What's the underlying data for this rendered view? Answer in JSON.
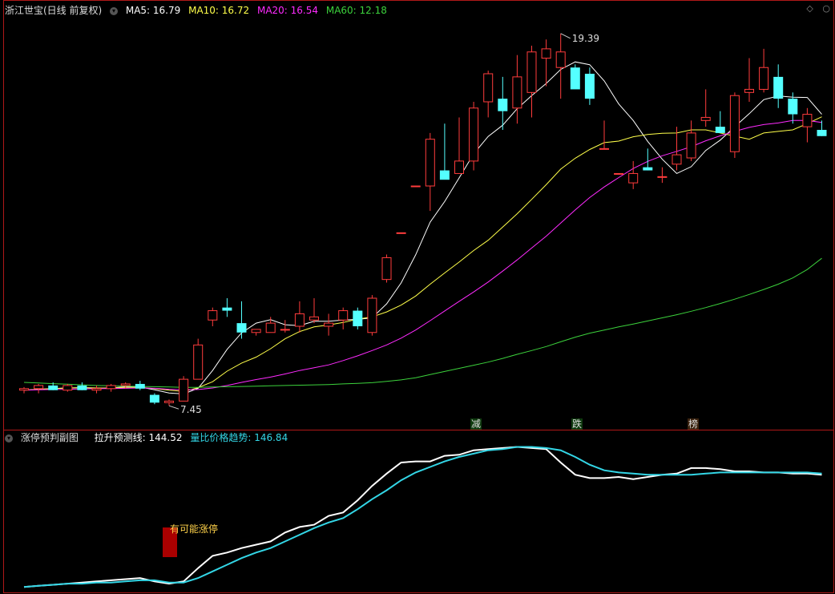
{
  "main_header": {
    "title": "浙江世宝(日线 前复权)",
    "ma5": "MA5: 16.79",
    "ma10": "MA10: 16.72",
    "ma20": "MA20: 16.54",
    "ma60": "MA60: 12.18"
  },
  "sub_header": {
    "title": "涨停预判副图",
    "line1": "拉升预测线: 144.52",
    "line2": "量比价格趋势: 146.84"
  },
  "annotations": {
    "high": "19.39",
    "low": "7.45",
    "limit_up_note": "有可能涨停",
    "tag_jian": "减",
    "tag_die": "跌",
    "tag_bang": "榜"
  },
  "colors": {
    "up": "#ff3c3c",
    "down": "#54ffff",
    "ma5": "#ffffff",
    "ma10": "#ffff4a",
    "ma20": "#ff2bff",
    "ma60": "#3cd23c",
    "line1": "#ffffff",
    "line2": "#33d6e6",
    "border": "#b01818"
  },
  "chart_data": [
    {
      "type": "candlestick",
      "ohlc": [
        [
          7.95,
          8.05,
          7.85,
          8.0
        ],
        [
          8.0,
          8.15,
          7.85,
          8.1
        ],
        [
          8.1,
          8.2,
          7.95,
          7.95
        ],
        [
          7.95,
          8.15,
          7.9,
          8.1
        ],
        [
          8.1,
          8.2,
          7.95,
          7.95
        ],
        [
          7.95,
          8.1,
          7.85,
          8.0
        ],
        [
          8.0,
          8.15,
          7.9,
          8.1
        ],
        [
          8.1,
          8.2,
          8.0,
          8.15
        ],
        [
          8.15,
          8.25,
          7.95,
          8.0
        ],
        [
          7.8,
          7.85,
          7.5,
          7.55
        ],
        [
          7.55,
          7.65,
          7.45,
          7.6
        ],
        [
          7.6,
          8.4,
          7.6,
          8.3
        ],
        [
          8.3,
          9.6,
          8.3,
          9.4
        ],
        [
          10.2,
          10.6,
          10.0,
          10.5
        ],
        [
          10.6,
          10.9,
          10.3,
          10.5
        ],
        [
          10.1,
          10.8,
          9.6,
          9.8
        ],
        [
          9.8,
          9.9,
          9.7,
          9.9
        ],
        [
          9.8,
          10.3,
          9.8,
          10.1
        ],
        [
          9.9,
          10.2,
          9.8,
          9.9
        ],
        [
          10.0,
          10.8,
          9.8,
          10.4
        ],
        [
          10.2,
          10.9,
          10.1,
          10.3
        ],
        [
          10.0,
          10.4,
          9.7,
          10.1
        ],
        [
          10.2,
          10.6,
          9.9,
          10.5
        ],
        [
          10.5,
          10.6,
          9.9,
          10.0
        ],
        [
          9.8,
          11.0,
          9.7,
          10.9
        ],
        [
          11.5,
          12.3,
          11.4,
          12.2
        ],
        [
          13.0,
          13.0,
          13.0,
          13.0
        ],
        [
          14.5,
          14.5,
          14.5,
          14.5
        ],
        [
          14.5,
          16.2,
          13.7,
          16.0
        ],
        [
          15.0,
          16.5,
          14.8,
          14.7
        ],
        [
          14.9,
          16.7,
          14.9,
          15.3
        ],
        [
          15.3,
          17.2,
          15.0,
          17.0
        ],
        [
          17.2,
          18.2,
          16.7,
          18.1
        ],
        [
          17.3,
          18.0,
          16.3,
          16.9
        ],
        [
          17.0,
          18.7,
          16.5,
          18.0
        ],
        [
          17.5,
          19.0,
          16.7,
          18.8
        ],
        [
          18.6,
          19.2,
          17.7,
          18.9
        ],
        [
          18.3,
          19.39,
          17.3,
          18.8
        ],
        [
          18.3,
          18.4,
          17.7,
          17.6
        ],
        [
          18.1,
          18.3,
          17.1,
          17.3
        ],
        [
          15.7,
          16.6,
          15.7,
          15.7
        ],
        [
          14.9,
          14.9,
          14.9,
          14.9
        ],
        [
          14.6,
          15.3,
          14.4,
          14.9
        ],
        [
          15.1,
          15.7,
          15.0,
          15.0
        ],
        [
          14.8,
          15.1,
          14.6,
          14.8
        ],
        [
          15.2,
          16.4,
          15.0,
          15.5
        ],
        [
          15.4,
          16.6,
          15.3,
          16.2
        ],
        [
          16.6,
          17.6,
          16.4,
          16.7
        ],
        [
          16.4,
          16.9,
          16.2,
          16.2
        ],
        [
          15.6,
          17.5,
          15.4,
          17.4
        ],
        [
          17.5,
          18.6,
          17.2,
          17.6
        ],
        [
          17.6,
          18.9,
          17.5,
          18.3
        ],
        [
          18.0,
          18.4,
          17.0,
          17.3
        ],
        [
          17.3,
          17.5,
          16.5,
          16.8
        ],
        [
          16.4,
          17.0,
          15.9,
          16.8
        ],
        [
          16.3,
          16.6,
          16.1,
          16.1
        ]
      ],
      "series": [
        {
          "name": "MA5",
          "start_index": 0,
          "values": [
            7.95,
            7.98,
            8.0,
            8.02,
            8.03,
            8.02,
            8.02,
            8.06,
            8.05,
            7.96,
            7.86,
            7.83,
            8.01,
            8.58,
            9.26,
            9.79,
            10.1,
            10.21,
            10.05,
            10.02,
            10.16,
            10.16,
            10.2,
            10.22,
            10.27,
            10.72,
            11.39,
            12.29,
            13.34,
            14.0,
            14.76,
            15.53,
            16.09,
            16.45,
            16.98,
            17.4,
            17.79,
            18.24,
            18.48,
            18.39,
            17.87,
            17.13,
            16.6,
            15.93,
            15.36,
            14.9,
            15.12,
            15.64,
            15.97,
            16.4,
            16.82,
            17.27,
            17.39,
            17.35,
            17.34,
            16.8
          ]
        },
        {
          "name": "MA10",
          "start_index": 0,
          "values": [
            7.95,
            7.98,
            8.0,
            8.02,
            8.03,
            8.02,
            8.02,
            8.04,
            8.04,
            8.0,
            7.95,
            7.91,
            8.03,
            8.22,
            8.56,
            8.82,
            9.01,
            9.28,
            9.6,
            9.83,
            9.98,
            10.04,
            10.12,
            10.23,
            10.3,
            10.46,
            10.68,
            10.97,
            11.35,
            11.71,
            12.06,
            12.43,
            12.76,
            13.18,
            13.61,
            14.07,
            14.54,
            15.04,
            15.39,
            15.67,
            15.89,
            15.94,
            16.08,
            16.15,
            16.19,
            16.2,
            16.3,
            16.3,
            16.2,
            16.1,
            16.0,
            16.2,
            16.25,
            16.3,
            16.5,
            16.72
          ]
        },
        {
          "name": "MA20",
          "start_index": 0,
          "values": [
            7.95,
            7.96,
            7.97,
            7.98,
            7.99,
            8.0,
            8.0,
            8.01,
            8.02,
            8.01,
            7.98,
            7.96,
            7.97,
            8.02,
            8.1,
            8.2,
            8.29,
            8.37,
            8.47,
            8.58,
            8.67,
            8.76,
            8.9,
            9.05,
            9.22,
            9.4,
            9.62,
            9.88,
            10.18,
            10.49,
            10.8,
            11.1,
            11.42,
            11.77,
            12.13,
            12.51,
            12.89,
            13.31,
            13.73,
            14.13,
            14.47,
            14.77,
            15.06,
            15.29,
            15.47,
            15.61,
            15.76,
            15.95,
            16.11,
            16.25,
            16.38,
            16.47,
            16.52,
            16.6,
            16.6,
            16.54
          ]
        },
        {
          "name": "MA60",
          "start_index": 0,
          "values": [
            8.2,
            8.18,
            8.16,
            8.14,
            8.12,
            8.1,
            8.09,
            8.08,
            8.07,
            8.06,
            8.05,
            8.04,
            8.04,
            8.05,
            8.06,
            8.07,
            8.08,
            8.09,
            8.1,
            8.11,
            8.12,
            8.13,
            8.15,
            8.17,
            8.19,
            8.23,
            8.28,
            8.35,
            8.45,
            8.55,
            8.65,
            8.75,
            8.85,
            8.97,
            9.1,
            9.22,
            9.35,
            9.5,
            9.65,
            9.78,
            9.88,
            9.98,
            10.07,
            10.17,
            10.27,
            10.37,
            10.48,
            10.6,
            10.73,
            10.87,
            11.02,
            11.18,
            11.35,
            11.55,
            11.82,
            12.18
          ]
        }
      ],
      "ylim": [
        7.3,
        19.9
      ]
    },
    {
      "type": "line",
      "series": [
        {
          "name": "拉升预测线",
          "values": [
            0,
            1,
            2,
            3,
            4,
            5,
            6,
            7,
            8,
            5,
            3,
            5,
            17,
            28,
            31,
            35,
            38,
            41,
            49,
            54,
            56,
            64,
            67,
            78,
            91,
            102,
            112,
            113,
            113,
            118,
            119,
            123,
            124,
            125,
            126,
            125,
            124,
            112,
            101,
            98,
            98,
            99,
            97,
            99,
            101,
            102,
            107,
            107,
            106,
            104,
            104,
            103,
            103,
            102,
            102,
            101
          ]
        },
        {
          "name": "量比价格趋势",
          "values": [
            0,
            1,
            2,
            3,
            3,
            4,
            4,
            5,
            6,
            6,
            4,
            4,
            8,
            14,
            20,
            26,
            31,
            35,
            41,
            47,
            53,
            58,
            62,
            70,
            79,
            87,
            96,
            103,
            108,
            113,
            117,
            120,
            123,
            124,
            126,
            126,
            125,
            123,
            117,
            110,
            105,
            103,
            102,
            101,
            101,
            101,
            101,
            102,
            103,
            103,
            103,
            103,
            103,
            103,
            103,
            102
          ]
        }
      ],
      "ylim": [
        -2,
        130
      ]
    }
  ]
}
